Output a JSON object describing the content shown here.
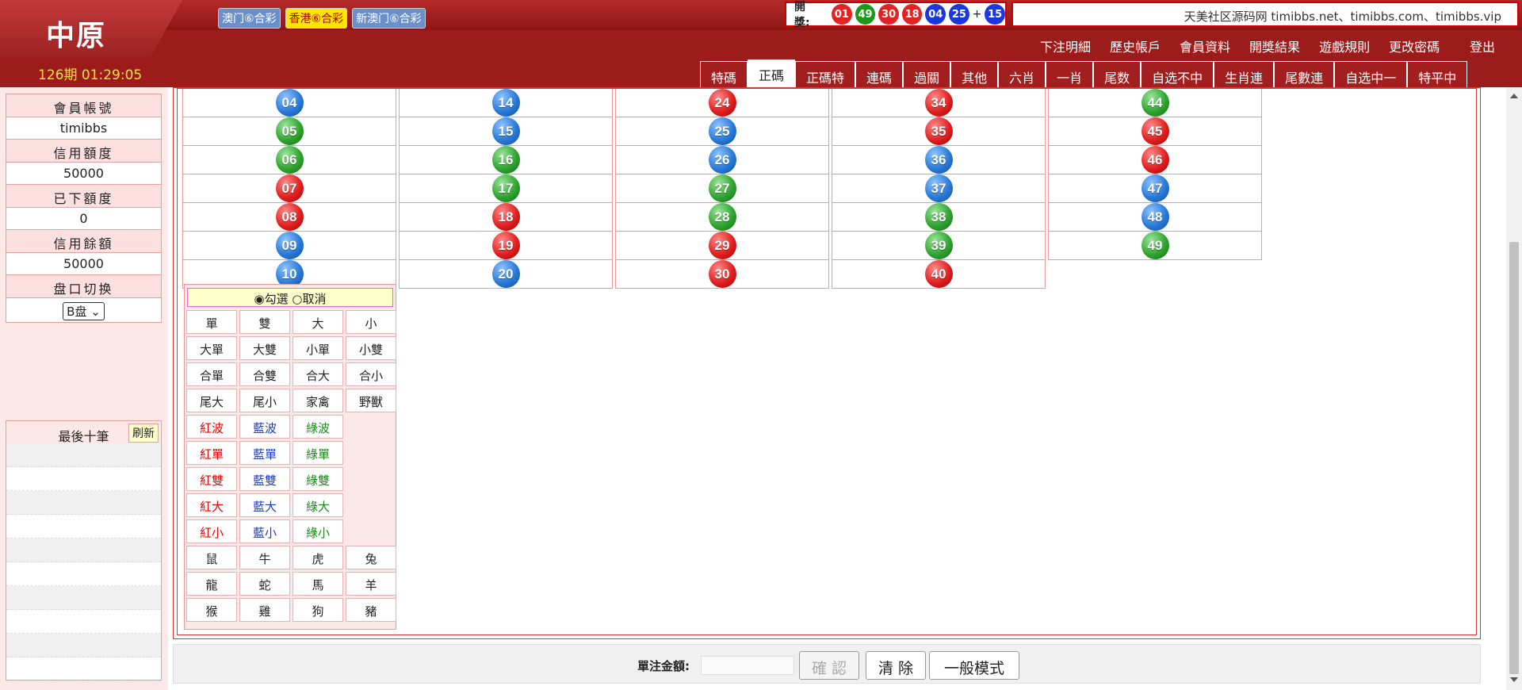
{
  "header": {
    "logo": "中原",
    "period": "126期 01:29:05",
    "lottery_tabs": [
      "澳门⑥合彩",
      "香港⑥合彩",
      "新澳门⑥合彩"
    ],
    "active_lottery": 1,
    "draw_label": "開獎:",
    "draw_balls": [
      {
        "n": "01",
        "color": "#e52222"
      },
      {
        "n": "49",
        "color": "#1a9a1a"
      },
      {
        "n": "30",
        "color": "#e52222"
      },
      {
        "n": "18",
        "color": "#e52222"
      },
      {
        "n": "04",
        "color": "#1a38e0"
      },
      {
        "n": "25",
        "color": "#1a38e0"
      },
      {
        "n": "15",
        "color": "#1a38e0"
      }
    ],
    "draw_plus": "+",
    "site_text": "天美社区源码网 timibbs.net、timibbs.com、timibbs.vip",
    "top_menu": [
      "下注明細",
      "歷史帳戶",
      "會員資料",
      "開獎結果",
      "遊戲規則",
      "更改密碼"
    ],
    "logout": "登出"
  },
  "tabs": [
    "特碼",
    "正碼",
    "正碼特",
    "連碼",
    "過關",
    "其他",
    "六肖",
    "一肖",
    "尾数",
    "自选不中",
    "生肖連",
    "尾數連",
    "自选中一",
    "特平中"
  ],
  "active_tab": 1,
  "sidebar": {
    "account_label": "會員帳號",
    "account_value": "timibbs",
    "credit_label": "信用額度",
    "credit_value": "50000",
    "used_label": "已下額度",
    "used_value": "0",
    "balance_label": "信用餘額",
    "balance_value": "50000",
    "plate_label": "盘口切换",
    "plate_value": "B盘",
    "last10_label": "最後十筆",
    "refresh_label": "刷新"
  },
  "numbers": [
    [
      {
        "n": "04",
        "c": "blue"
      },
      {
        "n": "05",
        "c": "green"
      },
      {
        "n": "06",
        "c": "green"
      },
      {
        "n": "07",
        "c": "red"
      },
      {
        "n": "08",
        "c": "red"
      },
      {
        "n": "09",
        "c": "blue"
      },
      {
        "n": "10",
        "c": "blue"
      }
    ],
    [
      {
        "n": "14",
        "c": "blue"
      },
      {
        "n": "15",
        "c": "blue"
      },
      {
        "n": "16",
        "c": "green"
      },
      {
        "n": "17",
        "c": "green"
      },
      {
        "n": "18",
        "c": "red"
      },
      {
        "n": "19",
        "c": "red"
      },
      {
        "n": "20",
        "c": "blue"
      }
    ],
    [
      {
        "n": "24",
        "c": "red"
      },
      {
        "n": "25",
        "c": "blue"
      },
      {
        "n": "26",
        "c": "blue"
      },
      {
        "n": "27",
        "c": "green"
      },
      {
        "n": "28",
        "c": "green"
      },
      {
        "n": "29",
        "c": "red"
      },
      {
        "n": "30",
        "c": "red"
      }
    ],
    [
      {
        "n": "34",
        "c": "red"
      },
      {
        "n": "35",
        "c": "red"
      },
      {
        "n": "36",
        "c": "blue"
      },
      {
        "n": "37",
        "c": "blue"
      },
      {
        "n": "38",
        "c": "green"
      },
      {
        "n": "39",
        "c": "green"
      },
      {
        "n": "40",
        "c": "red"
      }
    ],
    [
      {
        "n": "44",
        "c": "green"
      },
      {
        "n": "45",
        "c": "red"
      },
      {
        "n": "46",
        "c": "red"
      },
      {
        "n": "47",
        "c": "blue"
      },
      {
        "n": "48",
        "c": "blue"
      },
      {
        "n": "49",
        "c": "green"
      }
    ]
  ],
  "quick": {
    "check_label": "勾選",
    "cancel_label": "取消",
    "buttons": [
      {
        "t": "單",
        "k": ""
      },
      {
        "t": "雙",
        "k": ""
      },
      {
        "t": "大",
        "k": ""
      },
      {
        "t": "小",
        "k": ""
      },
      {
        "t": "大單",
        "k": ""
      },
      {
        "t": "大雙",
        "k": ""
      },
      {
        "t": "小單",
        "k": ""
      },
      {
        "t": "小雙",
        "k": ""
      },
      {
        "t": "合單",
        "k": ""
      },
      {
        "t": "合雙",
        "k": ""
      },
      {
        "t": "合大",
        "k": ""
      },
      {
        "t": "合小",
        "k": ""
      },
      {
        "t": "尾大",
        "k": ""
      },
      {
        "t": "尾小",
        "k": ""
      },
      {
        "t": "家禽",
        "k": ""
      },
      {
        "t": "野獸",
        "k": ""
      },
      {
        "t": "紅波",
        "k": "r"
      },
      {
        "t": "藍波",
        "k": "b"
      },
      {
        "t": "綠波",
        "k": "g"
      },
      {
        "t": "",
        "k": "empty"
      },
      {
        "t": "紅單",
        "k": "r"
      },
      {
        "t": "藍單",
        "k": "b"
      },
      {
        "t": "綠單",
        "k": "g"
      },
      {
        "t": "",
        "k": "empty"
      },
      {
        "t": "紅雙",
        "k": "r"
      },
      {
        "t": "藍雙",
        "k": "b"
      },
      {
        "t": "綠雙",
        "k": "g"
      },
      {
        "t": "",
        "k": "empty"
      },
      {
        "t": "紅大",
        "k": "r"
      },
      {
        "t": "藍大",
        "k": "b"
      },
      {
        "t": "綠大",
        "k": "g"
      },
      {
        "t": "",
        "k": "empty"
      },
      {
        "t": "紅小",
        "k": "r"
      },
      {
        "t": "藍小",
        "k": "b"
      },
      {
        "t": "綠小",
        "k": "g"
      },
      {
        "t": "",
        "k": "empty"
      },
      {
        "t": "鼠",
        "k": ""
      },
      {
        "t": "牛",
        "k": ""
      },
      {
        "t": "虎",
        "k": ""
      },
      {
        "t": "兔",
        "k": ""
      },
      {
        "t": "龍",
        "k": ""
      },
      {
        "t": "蛇",
        "k": ""
      },
      {
        "t": "馬",
        "k": ""
      },
      {
        "t": "羊",
        "k": ""
      },
      {
        "t": "猴",
        "k": ""
      },
      {
        "t": "雞",
        "k": ""
      },
      {
        "t": "狗",
        "k": ""
      },
      {
        "t": "豬",
        "k": ""
      }
    ]
  },
  "footer": {
    "amount_label": "單注金額:",
    "confirm_label": "確 認",
    "clear_label": "清 除",
    "mode_label": "一般模式"
  }
}
